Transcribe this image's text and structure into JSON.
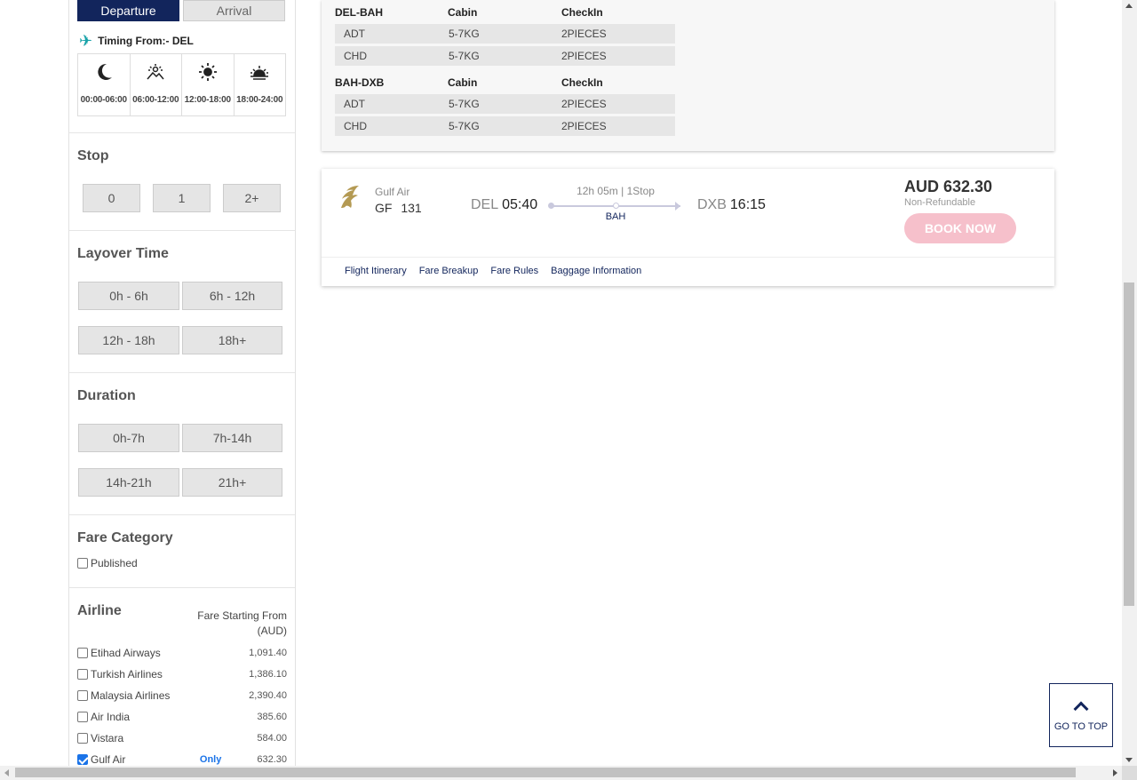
{
  "tabs": {
    "departure": "Departure",
    "arrival": "Arrival"
  },
  "timing": {
    "title": "Timing From:- DEL",
    "slots": [
      {
        "label": "00:00-06:00",
        "icon": "moon-icon"
      },
      {
        "label": "06:00-12:00",
        "icon": "sunrise-icon"
      },
      {
        "label": "12:00-18:00",
        "icon": "sun-icon"
      },
      {
        "label": "18:00-24:00",
        "icon": "sunset-icon"
      }
    ]
  },
  "stop": {
    "title": "Stop",
    "options": [
      "0",
      "1",
      "2+"
    ]
  },
  "layover": {
    "title": "Layover Time",
    "options": [
      "0h - 6h",
      "6h - 12h",
      "12h - 18h",
      "18h+"
    ]
  },
  "duration": {
    "title": "Duration",
    "options": [
      "0h-7h",
      "7h-14h",
      "14h-21h",
      "21h+"
    ]
  },
  "fare_category": {
    "title": "Fare Category",
    "options": [
      {
        "label": "Published",
        "checked": false
      }
    ]
  },
  "airline_filter": {
    "title": "Airline",
    "fare_from": "Fare Starting From (AUD)",
    "only_label": "Only",
    "items": [
      {
        "name": "Etihad Airways",
        "price": "1,091.40",
        "checked": false
      },
      {
        "name": "Turkish Airlines",
        "price": "1,386.10",
        "checked": false
      },
      {
        "name": "Malaysia Airlines",
        "price": "2,390.40",
        "checked": false
      },
      {
        "name": "Air India",
        "price": "385.60",
        "checked": false
      },
      {
        "name": "Vistara",
        "price": "584.00",
        "checked": false
      },
      {
        "name": "Gulf Air",
        "price": "632.30",
        "checked": true
      }
    ]
  },
  "baggage": {
    "columns": [
      "Cabin",
      "CheckIn"
    ],
    "segments": [
      {
        "route": "DEL-BAH",
        "rows": [
          [
            "ADT",
            "5-7KG",
            "2PIECES"
          ],
          [
            "CHD",
            "5-7KG",
            "2PIECES"
          ]
        ]
      },
      {
        "route": "BAH-DXB",
        "rows": [
          [
            "ADT",
            "5-7KG",
            "2PIECES"
          ],
          [
            "CHD",
            "5-7KG",
            "2PIECES"
          ]
        ]
      }
    ]
  },
  "flight": {
    "airline": "Gulf Air",
    "flight_no": "GF 131",
    "dep_code": "DEL",
    "dep_time": "05:40",
    "arr_code": "DXB",
    "arr_time": "16:15",
    "duration": "12h 05m | 1Stop",
    "via": "BAH",
    "price": "AUD 632.30",
    "refund": "Non-Refundable",
    "book": "BOOK NOW",
    "links": [
      "Flight Itinerary",
      "Fare Breakup",
      "Fare Rules",
      "Baggage Information"
    ]
  },
  "go_to_top": "GO TO TOP",
  "colors": {
    "primary": "#12255c",
    "book": "#f6c0cb",
    "accent": "#19a3a9"
  }
}
